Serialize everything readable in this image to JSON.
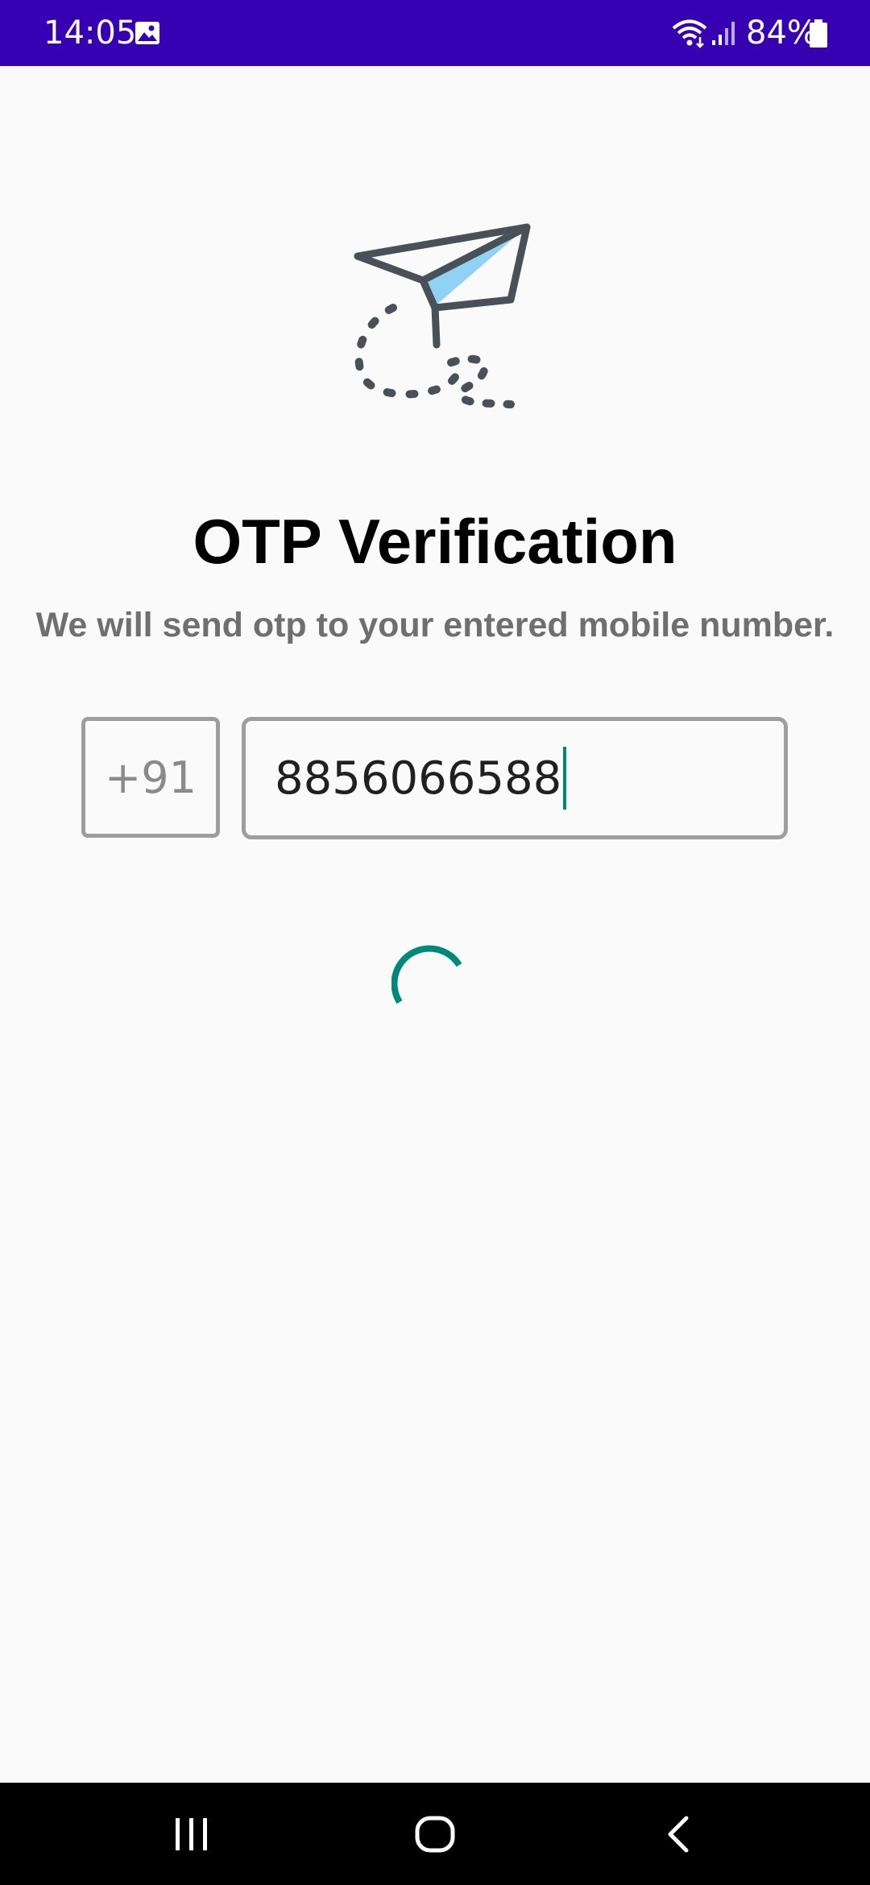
{
  "status_bar": {
    "time": "14:05",
    "battery": "84%",
    "icons": [
      "gallery-icon",
      "wifi-icon",
      "signal-icon",
      "battery-icon"
    ]
  },
  "main": {
    "illustration": "paper-plane-icon",
    "title": "OTP Verification",
    "subtitle": "We will send otp to your entered mobile number.",
    "country_code": "+91",
    "phone_number": "8856066588",
    "loading": true
  },
  "nav_bar": {
    "icons": [
      "recents-icon",
      "home-icon",
      "back-icon"
    ]
  },
  "colors": {
    "status_bar": "#3700b3",
    "background": "#fafafa",
    "accent": "#00897b",
    "input_border": "#9e9e9e",
    "subtitle": "#6f6f6f"
  }
}
